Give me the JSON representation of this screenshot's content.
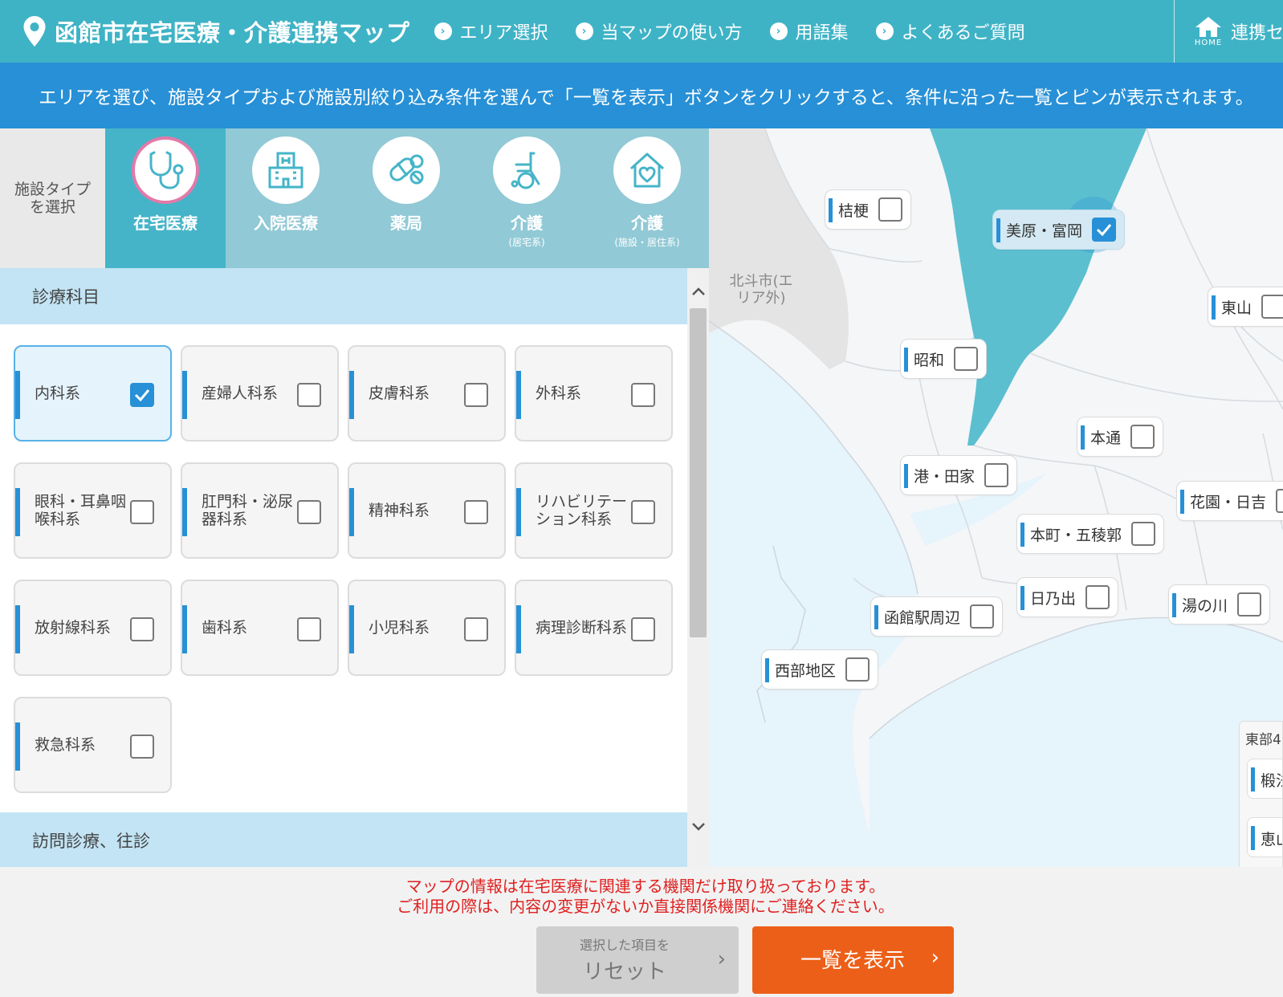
{
  "header": {
    "title": "函館市在宅医療・介護連携マップ",
    "nav": [
      "エリア選択",
      "当マップの使い方",
      "用語集",
      "よくあるご質問"
    ],
    "home_caption": "HOME",
    "home_text": "連携セ"
  },
  "notice": "エリアを選び、施設タイプおよび施設別絞り込み条件を選んで「一覧を表示」ボタンをクリックすると、条件に沿った一覧とピンが表示されます。",
  "facility_tabs": {
    "label": "施設タイプを選択",
    "items": [
      {
        "name": "在宅医療",
        "sub": "",
        "icon": "stethoscope-icon",
        "active": true
      },
      {
        "name": "入院医療",
        "sub": "",
        "icon": "hospital-icon",
        "active": false
      },
      {
        "name": "薬局",
        "sub": "",
        "icon": "pills-icon",
        "active": false
      },
      {
        "name": "介護",
        "sub": "(居宅系)",
        "icon": "wheelchair-icon",
        "active": false
      },
      {
        "name": "介護",
        "sub": "(施設・居住系)",
        "icon": "house-heart-icon",
        "active": false
      }
    ]
  },
  "filters": {
    "section1": "診療科目",
    "departments": [
      {
        "label": "内科系",
        "checked": true
      },
      {
        "label": "産婦人科系",
        "checked": false
      },
      {
        "label": "皮膚科系",
        "checked": false
      },
      {
        "label": "外科系",
        "checked": false
      },
      {
        "label": "眼科・耳鼻咽喉科系",
        "checked": false
      },
      {
        "label": "肛門科・泌尿器科系",
        "checked": false
      },
      {
        "label": "精神科系",
        "checked": false
      },
      {
        "label": "リハビリテーション科系",
        "checked": false
      },
      {
        "label": "放射線科系",
        "checked": false
      },
      {
        "label": "歯科系",
        "checked": false
      },
      {
        "label": "小児科系",
        "checked": false
      },
      {
        "label": "病理診断科系",
        "checked": false
      },
      {
        "label": "救急科系",
        "checked": false
      }
    ],
    "section2": "訪問診療、往診"
  },
  "map": {
    "outside_label": "北斗市(エリア外)",
    "areas": [
      {
        "name": "桔梗",
        "checked": false
      },
      {
        "name": "美原・富岡",
        "checked": true
      },
      {
        "name": "東山",
        "checked": false
      },
      {
        "name": "昭和",
        "checked": false
      },
      {
        "name": "本通",
        "checked": false
      },
      {
        "name": "港・田家",
        "checked": false
      },
      {
        "name": "花園・日吉",
        "checked": false
      },
      {
        "name": "本町・五稜郭",
        "checked": false
      },
      {
        "name": "日乃出",
        "checked": false
      },
      {
        "name": "湯の川",
        "checked": false
      },
      {
        "name": "函館駅周辺",
        "checked": false
      },
      {
        "name": "西部地区",
        "checked": false
      }
    ],
    "east_panel": {
      "title": "東部4",
      "items": [
        "椴法",
        "恵山"
      ]
    }
  },
  "footer": {
    "disclaimer": [
      "マップの情報は在宅医療に関連する機関だけ取り扱っております。",
      "ご利用の際は、内容の変更がないか直接関係機関にご連絡ください。"
    ],
    "reset_small": "選択した項目を",
    "reset_big": "リセット",
    "list_button": "一覧を表示"
  },
  "colors": {
    "header": "#3fb3c6",
    "notice": "#2790d6",
    "accent": "#2790d6",
    "primary_button": "#ec5f18",
    "disclaimer": "#e02020",
    "selected_region": "#5cbfd0"
  }
}
